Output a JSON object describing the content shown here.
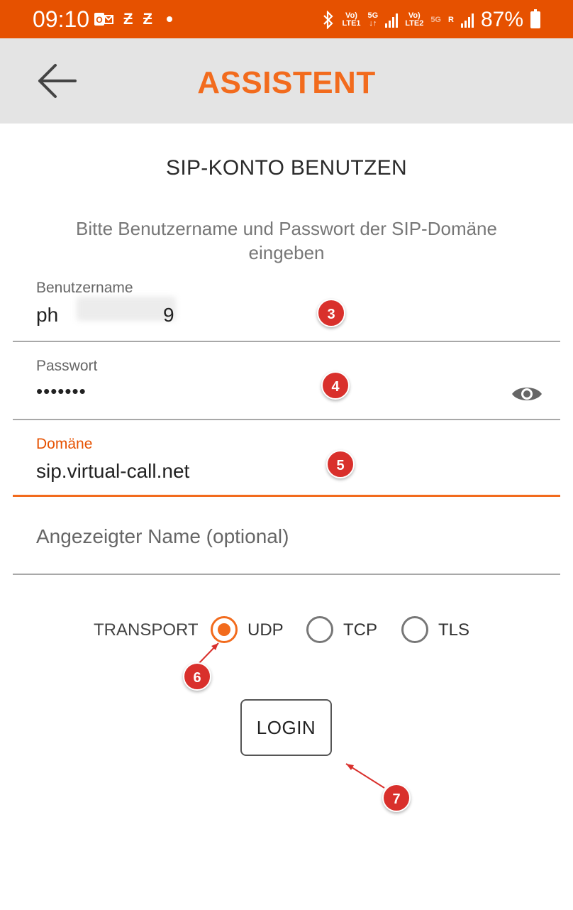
{
  "status_bar": {
    "time": "09:10",
    "left_icons": [
      "outlook-icon",
      "z-icon",
      "z-icon",
      "dot-icon"
    ],
    "network_1": "LTE1",
    "network_2": "LTE2",
    "badge_5g": "5G",
    "roaming": "R",
    "battery": "87%"
  },
  "app_bar": {
    "title": "ASSISTENT",
    "back_icon": "arrow-left-icon"
  },
  "section_title": "SIP-KONTO BENUTZEN",
  "instructions": "Bitte Benutzername und Passwort der SIP-Domäne eingeben",
  "fields": {
    "username": {
      "label": "Benutzername",
      "value_start": "ph",
      "value_end": "9"
    },
    "password": {
      "label": "Passwort",
      "value": "•••••••"
    },
    "domain": {
      "label": "Domäne",
      "value": "sip.virtual-call.net"
    },
    "display_name": {
      "placeholder": "Angezeigter Name (optional)"
    }
  },
  "transport": {
    "label": "TRANSPORT",
    "options": [
      {
        "label": "UDP",
        "checked": true
      },
      {
        "label": "TCP",
        "checked": false
      },
      {
        "label": "TLS",
        "checked": false
      }
    ]
  },
  "login_label": "LOGIN",
  "annotations": [
    "3",
    "4",
    "5",
    "6",
    "7"
  ],
  "colors": {
    "accent": "#f26b1d",
    "status_bar": "#e65100",
    "app_bar": "#e4e4e4",
    "badge": "#d9302c"
  }
}
